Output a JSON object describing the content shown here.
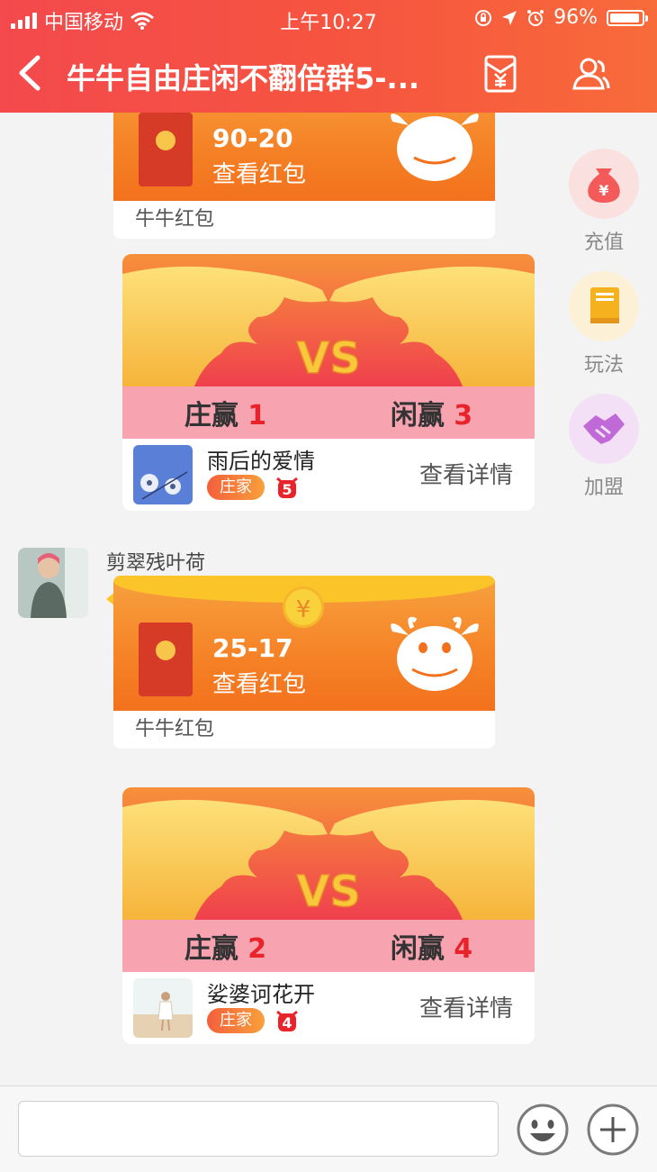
{
  "status_bar": {
    "carrier": "中国移动",
    "time": "上午10:27",
    "battery": "96%",
    "battery_level": 0.96
  },
  "nav": {
    "title": "牛牛自由庄闲不翻倍群5-...",
    "back_icon": "chevron-left-icon",
    "redpacket_icon": "red-envelope-yen-icon",
    "members_icon": "group-members-icon"
  },
  "side_actions": [
    {
      "label": "充值",
      "icon": "money-bag-yen-icon",
      "color": "#f45a5a"
    },
    {
      "label": "玩法",
      "icon": "book-icon",
      "color": "#f6b21e"
    },
    {
      "label": "加盟",
      "icon": "handshake-icon",
      "color": "#c06ad8"
    }
  ],
  "messages": {
    "red_packet_1": {
      "amount": "90-20",
      "view_label": "查看红包",
      "footer": "牛牛红包"
    },
    "vs_1": {
      "vs_text": "VS",
      "banker_label": "庄赢",
      "banker_wins": "1",
      "player_label": "闲赢",
      "player_wins": "3",
      "user_name": "雨后的爱情",
      "role_badge": "庄家",
      "cow_points": "5",
      "detail_label": "查看详情"
    },
    "sender_2": {
      "name": "剪翠残叶荷"
    },
    "red_packet_2": {
      "coin_symbol": "¥",
      "amount": "25-17",
      "view_label": "查看红包",
      "footer": "牛牛红包"
    },
    "vs_2": {
      "vs_text": "VS",
      "banker_label": "庄赢",
      "banker_wins": "2",
      "player_label": "闲赢",
      "player_wins": "4",
      "user_name": "娑婆诃花开",
      "role_badge": "庄家",
      "cow_points": "4",
      "detail_label": "查看详情"
    }
  },
  "input_bar": {
    "placeholder": "",
    "emoji_icon": "emoji-smile-icon",
    "plus_icon": "plus-circle-icon"
  },
  "colors": {
    "header_start": "#f4494d",
    "header_end": "#f86b3a",
    "score_win": "#e8242a",
    "score_band": "#f7a3b0"
  }
}
